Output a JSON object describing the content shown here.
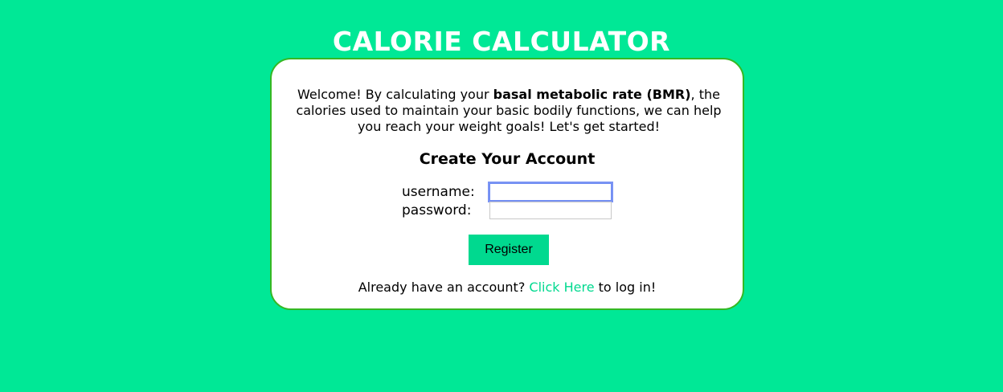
{
  "app_title": "CALORIE CALCULATOR",
  "intro": {
    "before_bold": "Welcome! By calculating your ",
    "bold": "basal metabolic rate (BMR)",
    "after_bold": ", the calories used to maintain your basic bodily functions, we can help you reach your weight goals! Let's get started!"
  },
  "form": {
    "heading": "Create Your Account",
    "username_label": "username:",
    "username_value": "",
    "password_label": "password:",
    "password_value": "",
    "register_label": "Register"
  },
  "login_prompt": {
    "before_link": "Already have an account? ",
    "link_text": "Click Here",
    "after_link": " to log in!"
  },
  "colors": {
    "background": "#00E896",
    "card_border": "#35B823",
    "accent": "#00D98F",
    "title_text": "#FFFFFF"
  }
}
